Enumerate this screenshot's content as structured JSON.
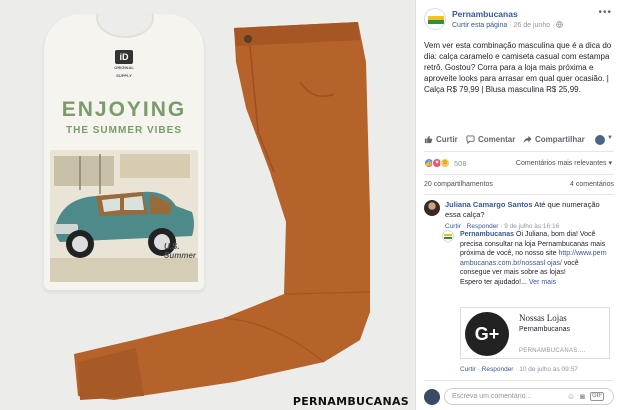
{
  "photo": {
    "tshirt_tag": "iD",
    "tshirt_brand_line": "ORIGINAL SUPPLY",
    "tshirt_headline": "ENJOYING",
    "tshirt_subline": "THE SUMMER VIBES",
    "tshirt_print_label": "U.S. Summer",
    "watermark": "PERNAMBUCANAS"
  },
  "post": {
    "page_name": "Pernambucanas",
    "meta_link": "Curtir esta página",
    "meta_separator": "·",
    "meta_date": "26 de junho",
    "meta_privacy_icon": "globe-icon",
    "more_icon": "more-dots-icon",
    "text_line1": "Vem ver esta combinação masculina que é a dica do dia: calça caramelo e camiseta casual com estampa retrô. Gostou? Corra para a loja mais próxima e aproveite looks para arrasar em qual quer ocasião. |",
    "text_line2": "Calça R$ 79,99 | Blusa masculina R$ 25,99."
  },
  "actions": {
    "like": "Curtir",
    "comment": "Comentar",
    "share": "Compartilhar"
  },
  "stats": {
    "reaction_count": "508",
    "sort_label": "Comentários mais relevantes ▾",
    "shares": "20 compartilhamentos",
    "comments": "4 comentários"
  },
  "comments": [
    {
      "author": "Juliana Camargo Santos",
      "text": "Até que numeração essa calça?",
      "like": "Curtir",
      "reply": "Responder",
      "time": "9 de julho às 16:16"
    }
  ],
  "reply": {
    "author": "Pernambucanas",
    "text": "Oi Juliana, bom dia! Você precisa consultar na loja Pernambucanas mais próxima de você, no nosso site",
    "link": "http://www.pernambucanas.com.br/nossasl ojas/",
    "text_after": "você consegue ver mais sobre as lojas!",
    "sign": "Espero ter ajudado!...",
    "more": "Ver mais",
    "like": "Curtir",
    "reply_action": "Responder",
    "time": "10 de julho às 09:57"
  },
  "link_card": {
    "logo": "G+",
    "title": "Nossas Lojas",
    "subtitle": "Pernambucanas",
    "domain": "PERNAMBUCANAS...."
  },
  "composer": {
    "placeholder": "Escreva um comentário...",
    "icons": [
      "emoji-icon",
      "camera-icon",
      "gif-icon"
    ]
  },
  "colors": {
    "facebook_link": "#365899",
    "pants": "#b5622b",
    "brand_yellow": "#f4c21b",
    "brand_green": "#2f8f3a"
  }
}
